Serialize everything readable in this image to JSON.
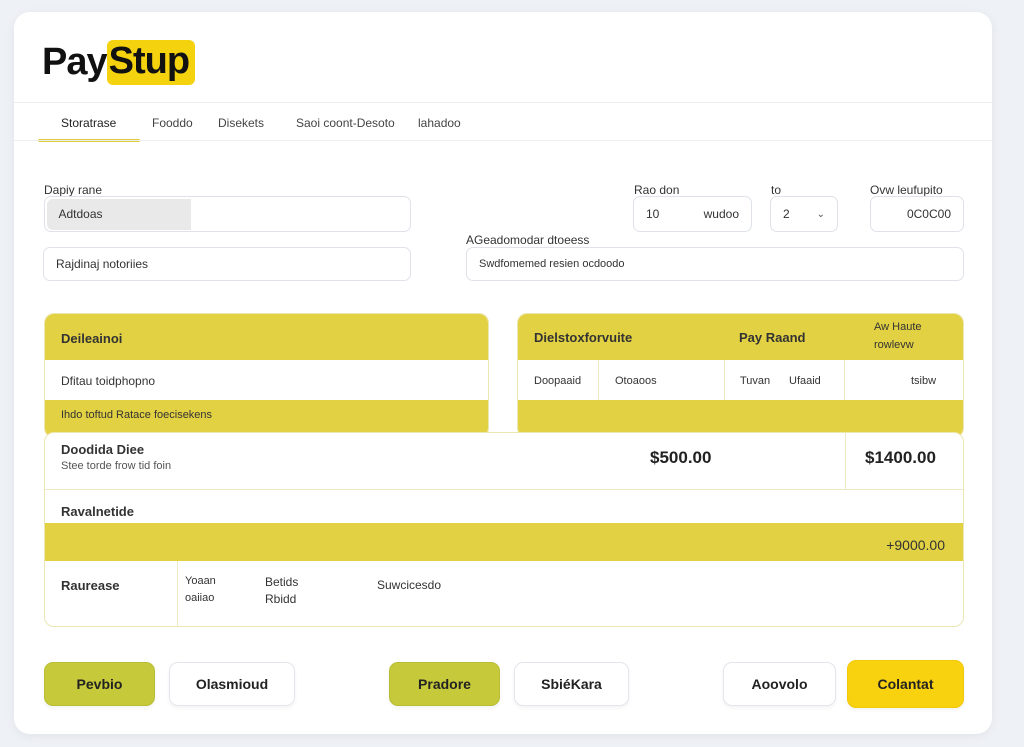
{
  "brand": {
    "part1": "Pay",
    "part2": "Stup"
  },
  "tabs": [
    {
      "label": "Storatrase",
      "active": true
    },
    {
      "label": "Fooddo",
      "active": false
    },
    {
      "label": "Disekets",
      "active": false
    },
    {
      "label": "Saoi coont-Desoto",
      "active": false
    },
    {
      "label": "lahadoo",
      "active": false
    }
  ],
  "form": {
    "display_label": "Dapiy rane",
    "display_prefix": "Adtdoas",
    "display_value": "",
    "address_field": "Rajdinaj notoriies",
    "date_label": "Rao don",
    "date_value_left": "10",
    "date_value_right": "wudoo",
    "to_label": "to",
    "to_value": "2",
    "dropdown_icon": "chevron-down-icon",
    "overview_label": "Ovw leufupito",
    "overview_value": "0C0C00",
    "agency_label": "AGeadomodar dtoeess",
    "agency_field": "Swdfomemed resien ocdoodo"
  },
  "left_panel": {
    "header": "Deileainoi",
    "row1": "Dfitau toidphopno",
    "row2": "Ihdo toftud Ratace foecisekens"
  },
  "right_panel": {
    "header_col1": "Dielstoxforvuite",
    "header_col2": "Pay Raand",
    "header_col3a": "Aw Haute",
    "header_col3b": "rowlevw",
    "sub_col1": "Doopaaid",
    "sub_col2": "Otoaoos",
    "sub_col3": "Tuvan",
    "sub_col4": "Ufaaid",
    "sub_col5": "tsibw"
  },
  "summary": {
    "title": "Doodida Diee",
    "subtitle": "Stee torde frow tid foin",
    "amount_mid": "$500.00",
    "amount_right": "$1400.00",
    "section_label": "Ravalnetide",
    "yellow_amount": "+9000.00",
    "footer_label": "Raurease",
    "footer_c1a": "Yoaan",
    "footer_c1b": "oaiiao",
    "footer_c2a": "Betids",
    "footer_c2b": "Rbidd",
    "footer_c3": "Suwcicesdo"
  },
  "actions": {
    "btn1": "Pevbio",
    "btn2": "Olasmioud",
    "btn3": "Pradore",
    "btn4": "SbiéKara",
    "btn5": "Aoovolo",
    "btn6": "Colantat"
  },
  "colors": {
    "accent_yellow": "#e2d142",
    "olive": "#c5c93a",
    "gold": "#f8d20e"
  }
}
